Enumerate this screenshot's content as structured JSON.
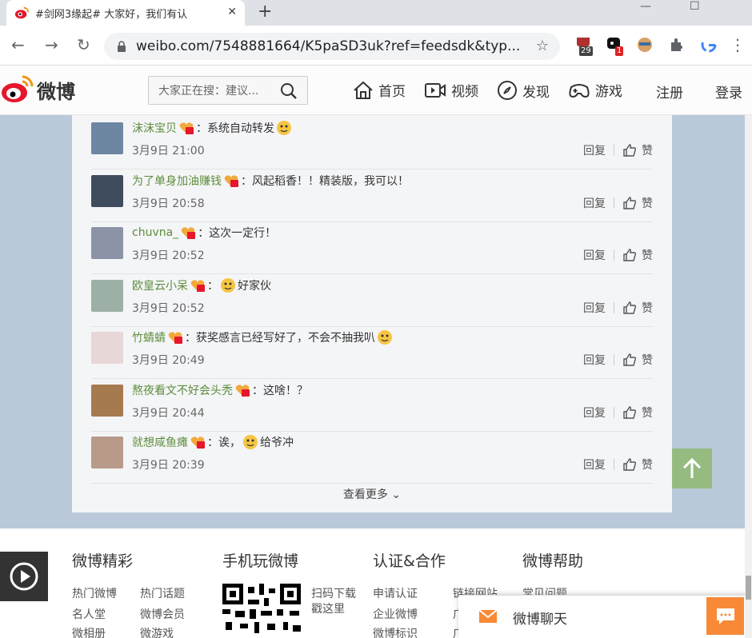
{
  "browser": {
    "tab_title": "#剑网3缘起# 大家好，我们有认",
    "url": "weibo.com/7548881664/K5paSD3uk?ref=feedsdk&typ...",
    "ext_badge_1": "29",
    "ext_badge_2": "1"
  },
  "header": {
    "logo_text": "微博",
    "search_placeholder": "大家正在搜：建议...",
    "nav": [
      "首页",
      "视频",
      "发现",
      "游戏"
    ],
    "register": "注册",
    "login": "登录"
  },
  "comments": [
    {
      "name": "沫沫宝贝",
      "text": "：系统自动转发",
      "emoji": true,
      "time": "3月9日 21:00",
      "avatar_color": "#6d87a2"
    },
    {
      "name": "为了单身加油赚钱",
      "text": "：风起稻香！！精装版，我可以！",
      "emoji": false,
      "time": "3月9日 20:58",
      "avatar_color": "#3f4c5e"
    },
    {
      "name": "chuvna_",
      "text": "：这次一定行！",
      "emoji": false,
      "time": "3月9日 20:52",
      "avatar_color": "#8b94a6"
    },
    {
      "name": "欧皇云小呆",
      "text": "：",
      "emoji": true,
      "text2": "好家伙",
      "time": "3月9日 20:52",
      "avatar_color": "#9db0a6"
    },
    {
      "name": "竹蜻蜻",
      "text": "：获奖感言已经写好了，不会不抽我叭",
      "emoji": true,
      "time": "3月9日 20:49",
      "avatar_color": "#e8d7d7"
    },
    {
      "name": "熬夜看文不好会头秃",
      "text": "：这啥！？",
      "emoji": false,
      "time": "3月9日 20:44",
      "avatar_color": "#a67a4f"
    },
    {
      "name": "就想咸鱼瘫",
      "text": "：诶，",
      "emoji": true,
      "text2": "给爷冲",
      "time": "3月9日 20:39",
      "avatar_color": "#b89a88"
    }
  ],
  "actions": {
    "reply": "回复",
    "like": "赞"
  },
  "more_label": "查看更多",
  "footer": {
    "col1_title": "微博精彩",
    "col1_links": [
      "热门微博",
      "热门话题",
      "名人堂",
      "微博会员",
      "微相册",
      "微游戏"
    ],
    "col2_title": "手机玩微博",
    "col2_text": [
      "扫码下载",
      "戳这里"
    ],
    "col3_title": "认证&合作",
    "col3_links": [
      "申请认证",
      "链接网站",
      "企业微博",
      "广",
      "微博标识",
      "广"
    ],
    "col4_title": "微博帮助",
    "col4_links": [
      "常见问题"
    ],
    "chat_label": "微博聊天"
  },
  "colors": {
    "accent_green": "#5d8d3b",
    "chat_orange": "#f88a37",
    "top_button": "#96bb80"
  }
}
